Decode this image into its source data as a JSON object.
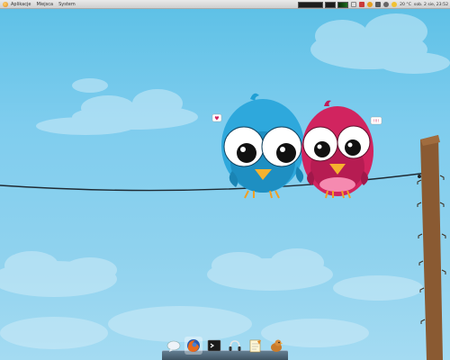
{
  "top_panel": {
    "menus": [
      "Aplikacje",
      "Miejsca",
      "System"
    ],
    "clock": "sob. 2 sie, 23:52",
    "temperature": "20 °C"
  },
  "speech_bubbles": {
    "blue_bird": "♥",
    "pink_bird": "!!!!"
  },
  "dock": {
    "items": [
      {
        "name": "chat",
        "icon": "speech-bubble-icon"
      },
      {
        "name": "firefox",
        "icon": "firefox-icon",
        "active": true
      },
      {
        "name": "terminal",
        "icon": "terminal-icon"
      },
      {
        "name": "music",
        "icon": "headphones-icon"
      },
      {
        "name": "notes",
        "icon": "notepad-icon"
      },
      {
        "name": "pidgin",
        "icon": "pidgin-icon"
      }
    ]
  }
}
